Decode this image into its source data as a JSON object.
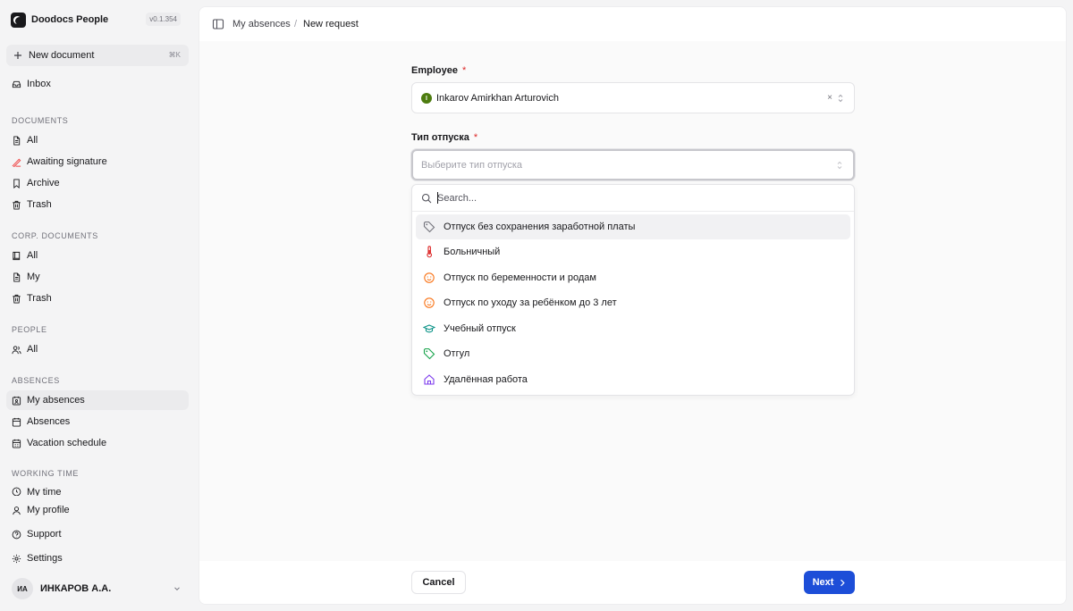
{
  "brand": {
    "name": "Doodocs People",
    "version": "v0.1.354"
  },
  "new_document": {
    "label": "New document",
    "shortcut": "⌘K"
  },
  "inbox": {
    "label": "Inbox"
  },
  "sections": {
    "documents": {
      "title": "Documents",
      "items": [
        {
          "label": "All",
          "icon": "file-icon"
        },
        {
          "label": "Awaiting signature",
          "icon": "signature-pen-icon"
        },
        {
          "label": "Archive",
          "icon": "bookmark-icon"
        },
        {
          "label": "Trash",
          "icon": "trash-icon"
        }
      ]
    },
    "corp_documents": {
      "title": "Corp. documents",
      "items": [
        {
          "label": "All",
          "icon": "book-icon"
        },
        {
          "label": "My",
          "icon": "file-icon"
        },
        {
          "label": "Trash",
          "icon": "trash-icon"
        }
      ]
    },
    "people": {
      "title": "People",
      "items": [
        {
          "label": "All",
          "icon": "users-icon"
        }
      ]
    },
    "absences": {
      "title": "Absences",
      "items": [
        {
          "label": "My absences",
          "icon": "calendar-user-icon",
          "active": true
        },
        {
          "label": "Absences",
          "icon": "calendar-icon"
        },
        {
          "label": "Vacation schedule",
          "icon": "calendar-grid-icon"
        }
      ]
    },
    "working_time": {
      "title": "Working time",
      "items": [
        {
          "label": "My time",
          "icon": "clock-icon"
        }
      ]
    }
  },
  "footer_nav": [
    {
      "label": "My profile",
      "icon": "user-icon"
    },
    {
      "label": "Support",
      "icon": "help-circle-icon"
    },
    {
      "label": "Settings",
      "icon": "gear-icon"
    }
  ],
  "user": {
    "initials": "ИА",
    "name": "ИНКАРОВ А.А."
  },
  "breadcrumb": {
    "parent": "My absences",
    "separator": "/",
    "current": "New request"
  },
  "form": {
    "employee": {
      "label": "Employee",
      "required_mark": "*",
      "avatar_letter": "I",
      "value": "Inkarov Amirkhan Arturovich",
      "clear": "×"
    },
    "leave_type": {
      "label": "Тип отпуска",
      "required_mark": "*",
      "placeholder": "Выберите тип отпуска"
    },
    "search": {
      "placeholder": "Search..."
    },
    "options": [
      {
        "label": "Отпуск без сохранения заработной платы",
        "icon": "tag-icon",
        "color": "#71717a",
        "highlighted": true
      },
      {
        "label": "Больничный",
        "icon": "thermometer-icon",
        "color": "#dc2626"
      },
      {
        "label": "Отпуск по беременности и родам",
        "icon": "baby-face-icon",
        "color": "#f97316"
      },
      {
        "label": "Отпуск по уходу за ребёнком до 3 лет",
        "icon": "baby-face-icon",
        "color": "#f97316"
      },
      {
        "label": "Учебный отпуск",
        "icon": "graduation-cap-icon",
        "color": "#0d9488"
      },
      {
        "label": "Отгул",
        "icon": "tag-icon",
        "color": "#16a34a"
      },
      {
        "label": "Удалённая работа",
        "icon": "home-icon",
        "color": "#7c3aed"
      }
    ]
  },
  "actions": {
    "cancel": "Cancel",
    "next": "Next"
  },
  "colors": {
    "accent": "#1d4ed8",
    "required": "#dc2626",
    "active_nav": "#ebebed"
  }
}
